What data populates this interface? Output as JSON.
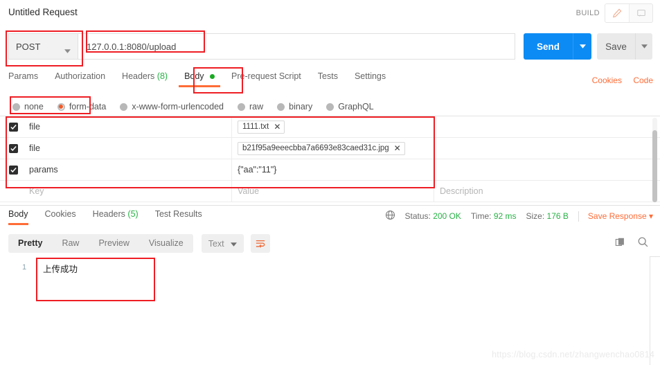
{
  "window": {
    "request_title": "Untitled Request",
    "build_label": "BUILD"
  },
  "icons": {
    "edit": "pencil-icon",
    "comment": "comment-icon",
    "globe": "globe-icon",
    "copy": "copy-icon",
    "search": "search-icon",
    "wrap": "wrap-lines-icon"
  },
  "url_bar": {
    "method": "POST",
    "url": "127.0.0.1:8080/upload",
    "send_label": "Send",
    "save_label": "Save"
  },
  "request_tabs": [
    {
      "label": "Params",
      "active": false
    },
    {
      "label": "Authorization",
      "active": false
    },
    {
      "label": "Headers",
      "count": "(8)",
      "active": false
    },
    {
      "label": "Body",
      "active": true,
      "dot": true
    },
    {
      "label": "Pre-request Script",
      "active": false
    },
    {
      "label": "Tests",
      "active": false
    },
    {
      "label": "Settings",
      "active": false
    }
  ],
  "request_links": {
    "cookies": "Cookies",
    "code": "Code"
  },
  "body_types": [
    {
      "label": "none",
      "selected": false
    },
    {
      "label": "form-data",
      "selected": true
    },
    {
      "label": "x-www-form-urlencoded",
      "selected": false
    },
    {
      "label": "raw",
      "selected": false
    },
    {
      "label": "binary",
      "selected": false
    },
    {
      "label": "GraphQL",
      "selected": false
    }
  ],
  "form_data": {
    "columns": {
      "key": "Key",
      "value": "Value",
      "description": "Description"
    },
    "rows": [
      {
        "checked": true,
        "key": "file",
        "value": "1111.txt",
        "is_file": true,
        "description": ""
      },
      {
        "checked": true,
        "key": "file",
        "value": "b21f95a9eeecbba7a6693e83caed31c.jpg",
        "is_file": true,
        "description": ""
      },
      {
        "checked": true,
        "key": "params",
        "value": "{\"aa\":\"11\"}",
        "is_file": false,
        "description": ""
      }
    ]
  },
  "response_tabs": [
    {
      "label": "Body",
      "active": true
    },
    {
      "label": "Cookies",
      "active": false
    },
    {
      "label": "Headers",
      "count": "(5)",
      "active": false
    },
    {
      "label": "Test Results",
      "active": false
    }
  ],
  "response_meta": {
    "status_label": "Status:",
    "status_value": "200 OK",
    "time_label": "Time:",
    "time_value": "92 ms",
    "size_label": "Size:",
    "size_value": "176 B",
    "save_response": "Save Response"
  },
  "response_toolbar": {
    "views": [
      {
        "label": "Pretty",
        "active": true
      },
      {
        "label": "Raw",
        "active": false
      },
      {
        "label": "Preview",
        "active": false
      },
      {
        "label": "Visualize",
        "active": false
      }
    ],
    "format": "Text"
  },
  "response_body": {
    "line_number": "1",
    "content": "上传成功"
  },
  "watermark": "https://blog.csdn.net/zhangwenchao0814",
  "colors": {
    "accent_orange": "#ff6c37",
    "send_blue": "#0d8bf4",
    "status_green": "#28b246",
    "annotation_red": "#ee1d23"
  }
}
